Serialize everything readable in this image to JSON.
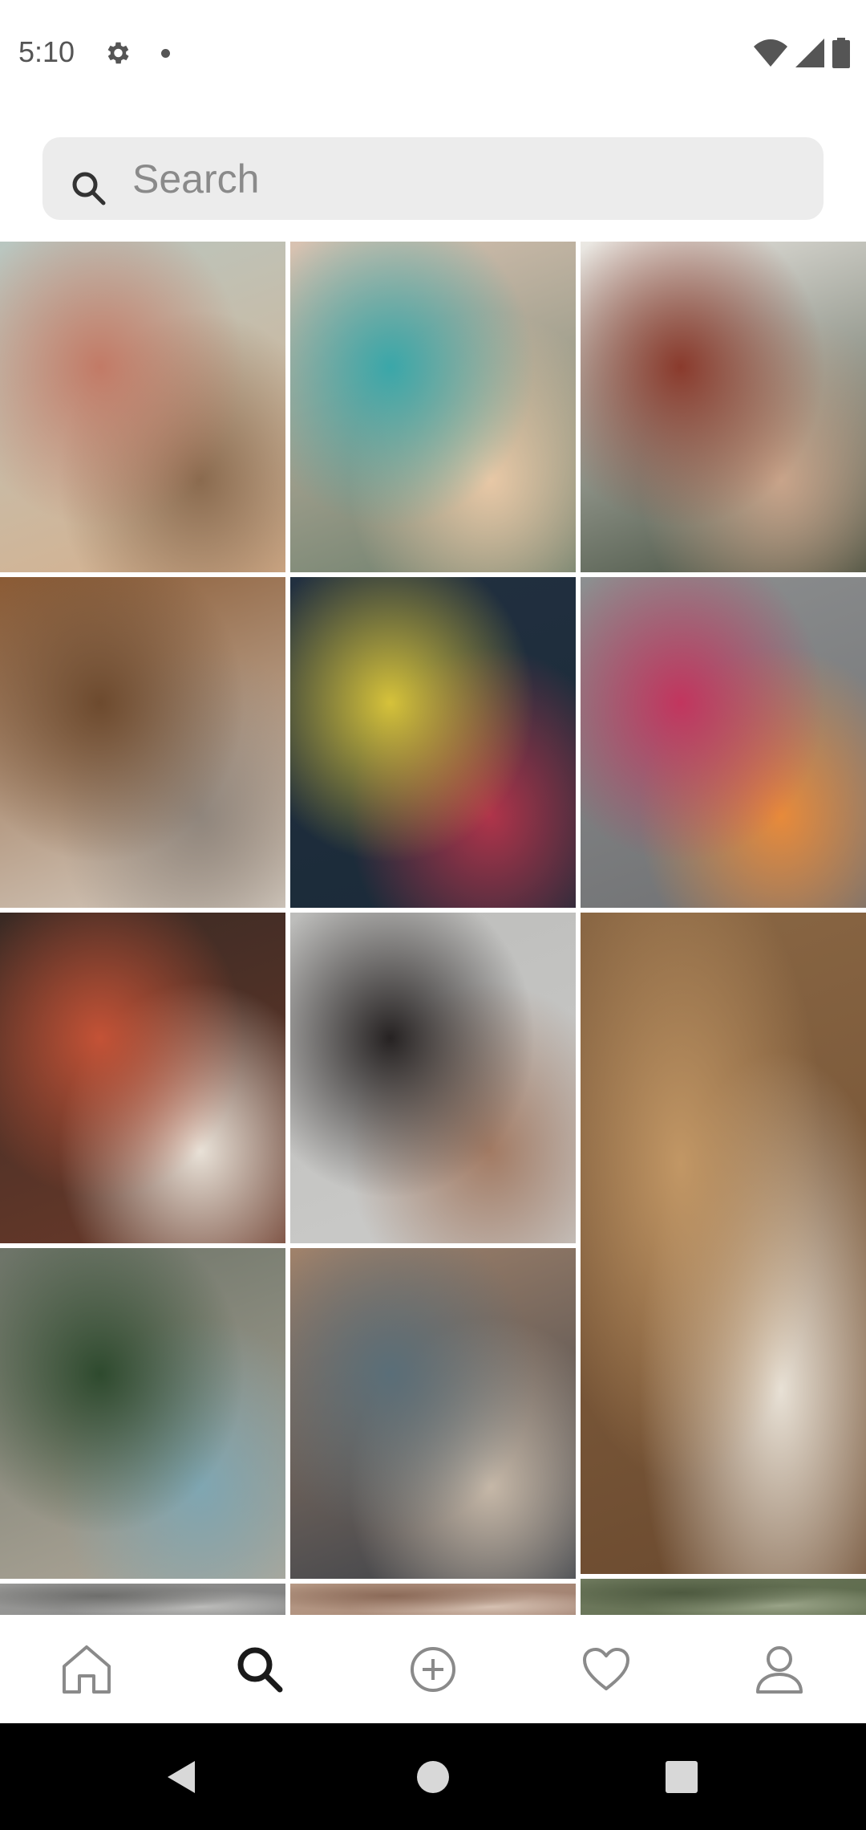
{
  "status_bar": {
    "time": "5:10",
    "icons": [
      "gear-icon",
      "notification-dot-icon",
      "wifi-icon",
      "cellular-signal-icon",
      "battery-icon"
    ]
  },
  "search": {
    "placeholder": "Search",
    "value": "",
    "icon": "search-icon"
  },
  "grid": {
    "tiles": [
      {
        "name": "photo-woman-winter-hat",
        "colors": [
          "#b9c6c0",
          "#c27a66",
          "#8a6a4e",
          "#d7b08c"
        ]
      },
      {
        "name": "photo-beach-coastline",
        "colors": [
          "#d9c3b2",
          "#3aa7a9",
          "#e8c8a6",
          "#6a7d6a"
        ]
      },
      {
        "name": "photo-mother-child-bed",
        "colors": [
          "#ece9e4",
          "#8a3a2c",
          "#c9a48a",
          "#3f4a3a"
        ]
      },
      {
        "name": "photo-living-room-sofa",
        "colors": [
          "#8a5a34",
          "#6d4a2e",
          "#8f857c",
          "#d8cfc4"
        ]
      },
      {
        "name": "photo-night-street-rain",
        "colors": [
          "#223040",
          "#d6c23a",
          "#b0344a",
          "#1a2a38"
        ]
      },
      {
        "name": "photo-smoothie-bowls",
        "colors": [
          "#8d8f90",
          "#c2355e",
          "#e88a3a",
          "#6f7072"
        ]
      },
      {
        "name": "photo-market-souvenirs",
        "colors": [
          "#3a2a24",
          "#c45236",
          "#e9e2d8",
          "#6b3a2a"
        ]
      },
      {
        "name": "photo-woman-portrait",
        "colors": [
          "#bdbdbb",
          "#262222",
          "#a27a63",
          "#cbcbc9"
        ]
      },
      {
        "name": "photo-burger-tea",
        "colors": [
          "#8a6744",
          "#c29765",
          "#e8e1d6",
          "#6b4a2f"
        ]
      },
      {
        "name": "photo-hiker-mountains",
        "colors": [
          "#6d7468",
          "#2e4a2e",
          "#7fa6b2",
          "#b0a89a"
        ]
      },
      {
        "name": "photo-venice-canal",
        "colors": [
          "#a0826b",
          "#5a6e78",
          "#c6b8a8",
          "#3a4048"
        ]
      },
      {
        "name": "photo-partial-bottom-left",
        "colors": [
          "#9a9a98",
          "#6e6e6c",
          "#bcbcba",
          "#808080"
        ]
      },
      {
        "name": "photo-partial-bottom-middle",
        "colors": [
          "#b79a86",
          "#8b6a58",
          "#d6c1b2",
          "#a08070"
        ]
      },
      {
        "name": "photo-partial-bottom-right",
        "colors": [
          "#6f7a5e",
          "#4e5a40",
          "#9aa488",
          "#5d6a4c"
        ]
      }
    ]
  },
  "bottom_nav": {
    "items": [
      {
        "name": "nav-home",
        "icon": "home-icon",
        "active": false
      },
      {
        "name": "nav-search",
        "icon": "search-icon",
        "active": true
      },
      {
        "name": "nav-add",
        "icon": "add-circle-icon",
        "active": false
      },
      {
        "name": "nav-activity",
        "icon": "heart-icon",
        "active": false
      },
      {
        "name": "nav-profile",
        "icon": "profile-icon",
        "active": false
      }
    ],
    "active_color": "#1a1a1a",
    "inactive_color": "#8a8a8a"
  },
  "system_nav": {
    "items": [
      "back-icon",
      "home-circle-icon",
      "recents-square-icon"
    ]
  }
}
